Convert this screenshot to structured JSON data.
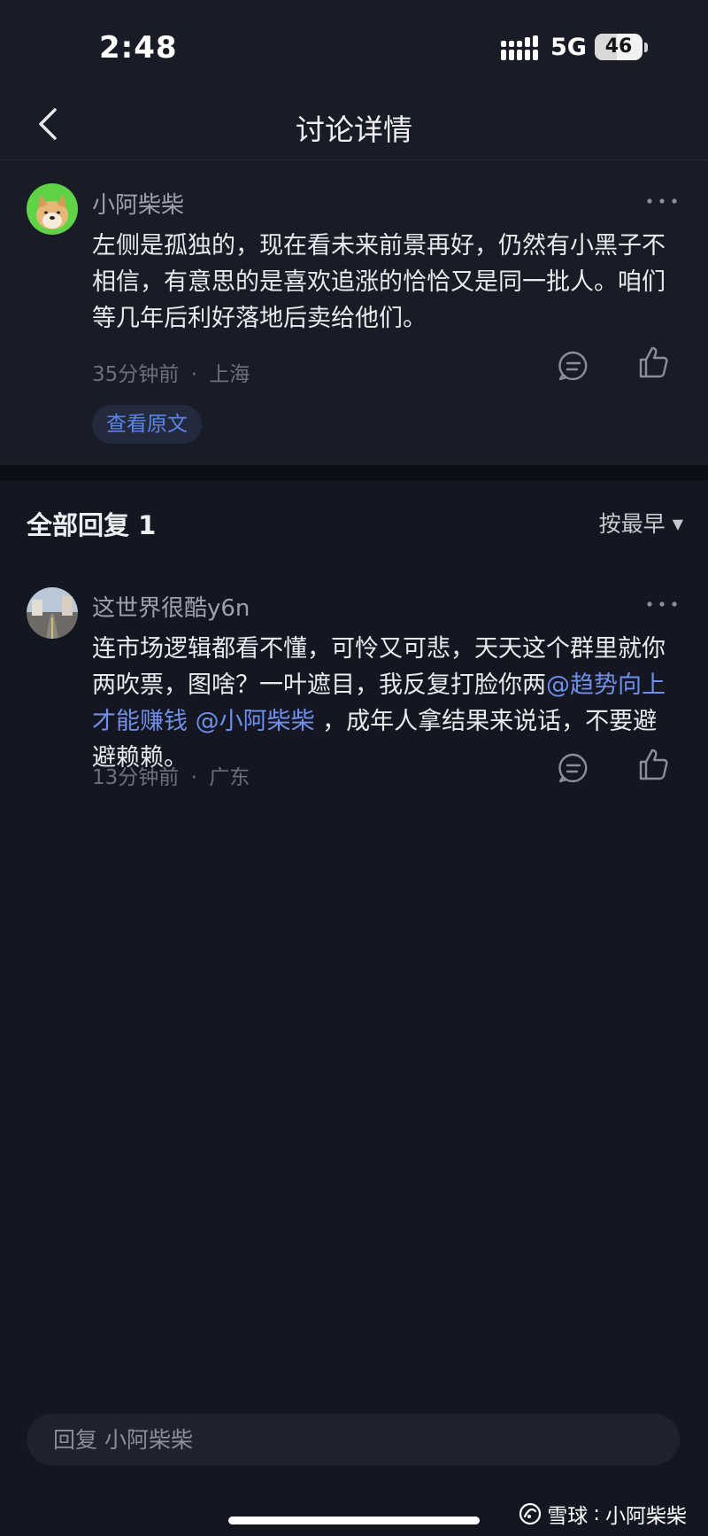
{
  "status_bar": {
    "time": "2:48",
    "network": "5G",
    "battery_level": "46",
    "battery_fraction": 0.46
  },
  "header": {
    "title": "讨论详情",
    "back_icon": "chevron-left-icon"
  },
  "post": {
    "author": "小阿柴柴",
    "content": "左侧是孤独的，现在看未来前景再好，仍然有小黑子不相信，有意思的是喜欢追涨的恰恰又是同一批人。咱们等几年后利好落地后卖给他们。",
    "time": "35分钟前",
    "location": "上海",
    "separator": "·",
    "view_original_label": "查看原文"
  },
  "replies": {
    "header": "全部回复 1",
    "sort_label": "按最早",
    "items": [
      {
        "author": "这世界很酷y6n",
        "content_parts": [
          {
            "text": "连市场逻辑都看不懂，可怜又可悲，天天这个群里就你两吹票，图啥？一叶遮目，我反复打脸你两",
            "type": "text"
          },
          {
            "text": "@趋势向上才能赚钱",
            "type": "mention"
          },
          {
            "text": " ",
            "type": "text"
          },
          {
            "text": "@小阿柴柴",
            "type": "mention"
          },
          {
            "text": " ，成年人拿结果来说话，不要避避赖赖。",
            "type": "text"
          }
        ],
        "time": "13分钟前",
        "location": "广东",
        "separator": "·"
      }
    ]
  },
  "reply_bar": {
    "placeholder": "回复 小阿柴柴"
  },
  "watermark": {
    "brand": "雪球",
    "separator": ":",
    "user": "小阿柴柴"
  },
  "colors": {
    "background": "#141722",
    "card": "#191b26",
    "mention": "#6f8fe8",
    "link": "#5b86e8"
  }
}
